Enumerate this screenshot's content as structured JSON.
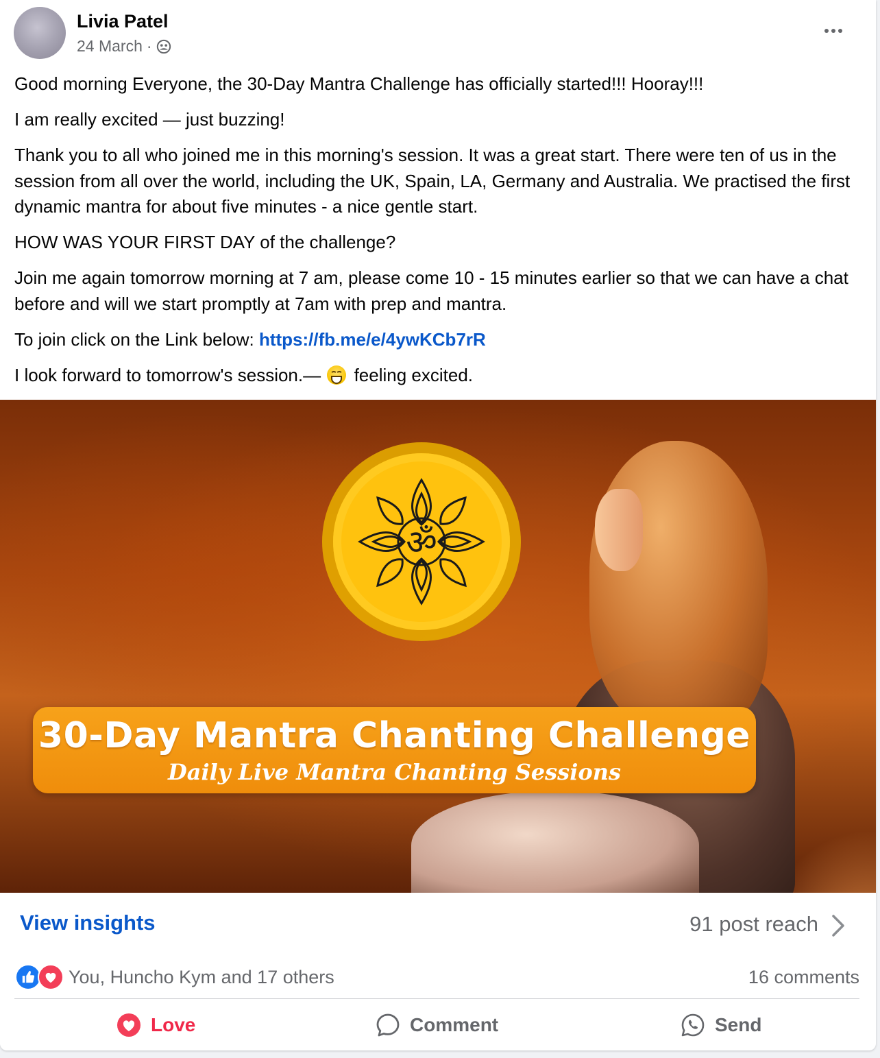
{
  "post": {
    "author": "Livia Patel",
    "date": "24 March",
    "separator": "·",
    "audience_icon": "group-icon",
    "paragraphs": {
      "p1": "Good morning Everyone, the 30-Day Mantra Challenge has officially started!!! Hooray!!!",
      "p2": "I am really excited — just buzzing!",
      "p3": "Thank you to all who joined me in this morning's session. It was a great start. There were ten of us in the session from all over the world, including the UK, Spain, LA, Germany and Australia. We practised the first dynamic mantra for about five minutes - a nice gentle start.",
      "p4": "HOW WAS YOUR FIRST DAY of the challenge?",
      "p5": "Join me again tomorrow morning at 7 am, please come 10 - 15 minutes earlier so that we can have a chat before and will we start promptly at 7am with prep and mantra.",
      "p6_prefix": "To join click on the Link below: ",
      "p6_link": "https://fb.me/e/4ywKCb7rR",
      "p7_prefix": "I look forward to tomorrow's session.— ",
      "p7_feeling": "feeling excited."
    },
    "image": {
      "banner_title": "30-Day Mantra Chanting Challenge",
      "banner_subtitle": "Daily Live Mantra Chanting Sessions",
      "logo_symbol": "ॐ"
    },
    "insights": {
      "link": "View insights",
      "reach": "91 post reach"
    },
    "reactions": {
      "summary": "You, Huncho Kym and 17 others",
      "comments": "16 comments",
      "icons": [
        "like-icon",
        "love-icon"
      ]
    },
    "actions": {
      "love": "Love",
      "comment": "Comment",
      "send": "Send"
    }
  },
  "colors": {
    "link": "#0a58ca",
    "love": "#f02849",
    "muted": "#65676b",
    "banner": "#f7a21a"
  }
}
